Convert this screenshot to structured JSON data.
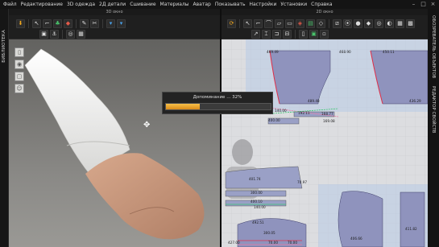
{
  "menu": {
    "items": [
      "Файл",
      "Редактирование",
      "3D одежда",
      "2Д детали",
      "Сшивание",
      "Материалы",
      "Аватар",
      "Показывать",
      "Настройки",
      "Установки",
      "Справка"
    ]
  },
  "window_buttons": [
    "–",
    "□",
    "×"
  ],
  "left_strip": {
    "label": "БИБЛИОТЕКА"
  },
  "right_strip": {
    "label_top": "ОБОЗРЕВАТЕЛЬ ОБЪЕКТОВ",
    "label_bottom": "РЕДАКТОР СВОЙСТВ"
  },
  "panel3d": {
    "title": "3D окно"
  },
  "panel2d": {
    "title": "2D окно",
    "piece_labels": [
      "469.49",
      "468.90",
      "450.11",
      "489.48",
      "436.29",
      "140.00",
      "192.11",
      "168.77",
      "169.08",
      "400.00",
      "401.74",
      "70.97",
      "300.00",
      "400.10",
      "140.00",
      "492.51",
      "406.66",
      "300.05",
      "411.82",
      "427.00",
      "70.00",
      "70.00"
    ]
  },
  "progress": {
    "text": "Допоминание ... 32%",
    "value": 0.32
  },
  "colors": {
    "accent": "#f3a81e",
    "pattern_fill": "#8f93bd",
    "seam_red": "#e0304a",
    "seam_pink": "#ee77a0",
    "seam_green": "#37c46f"
  }
}
